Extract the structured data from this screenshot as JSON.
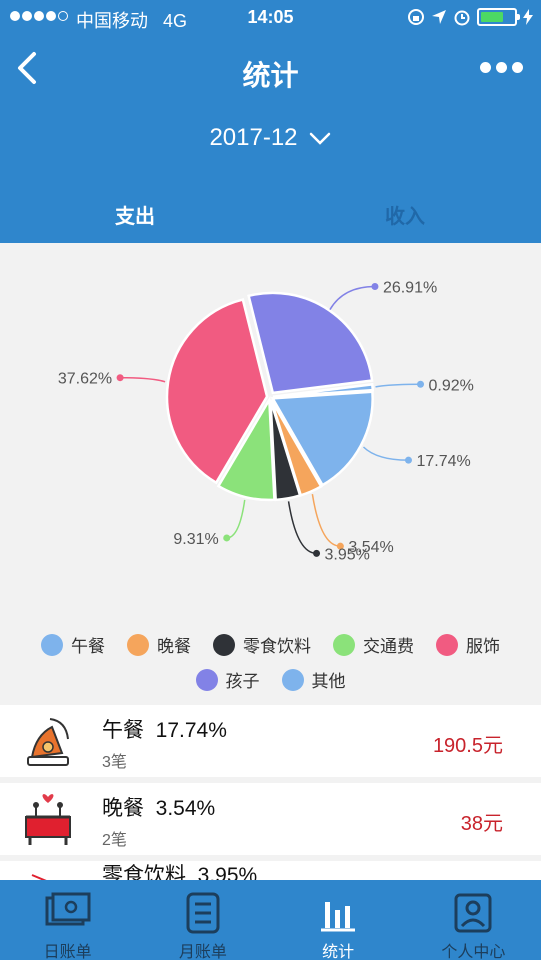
{
  "status_bar": {
    "carrier": "中国移动",
    "network": "4G",
    "time": "14:05"
  },
  "nav": {
    "title": "统计"
  },
  "period": {
    "value": "2017-12"
  },
  "tabs": [
    {
      "label": "支出",
      "active": true
    },
    {
      "label": "收入",
      "active": false
    }
  ],
  "chart_data": {
    "type": "pie",
    "title": "",
    "slices": [
      {
        "label": "孩子",
        "value": 26.91,
        "display": "26.91%",
        "color": "#8282e6"
      },
      {
        "label": "其他",
        "value": 0.92,
        "display": "0.92%",
        "color": "#7eb3ec"
      },
      {
        "label": "午餐",
        "value": 17.74,
        "display": "17.74%",
        "color": "#7eb3ec"
      },
      {
        "label": "晚餐",
        "value": 3.54,
        "display": "3.54%",
        "color": "#f5a55c"
      },
      {
        "label": "零食饮料",
        "value": 3.95,
        "display": "3.95%",
        "color": "#2f3237"
      },
      {
        "label": "交通费",
        "value": 9.31,
        "display": "9.31%",
        "color": "#8be27a"
      },
      {
        "label": "服饰",
        "value": 37.62,
        "display": "37.62%",
        "color": "#f15b81"
      }
    ],
    "legend_placement": "bottom"
  },
  "legend": [
    {
      "label": "午餐",
      "color": "#7eb3ec"
    },
    {
      "label": "晚餐",
      "color": "#f5a55c"
    },
    {
      "label": "零食饮料",
      "color": "#2f3237"
    },
    {
      "label": "交通费",
      "color": "#8be27a"
    },
    {
      "label": "服饰",
      "color": "#f15b81"
    },
    {
      "label": "孩子",
      "color": "#8282e6"
    },
    {
      "label": "其他",
      "color": "#7eb3ec"
    }
  ],
  "records": [
    {
      "name": "午餐",
      "percent": "17.74%",
      "count": "3笔",
      "amount": "190.5元",
      "icon": "lunch-icon"
    },
    {
      "name": "晚餐",
      "percent": "3.54%",
      "count": "2笔",
      "amount": "38元",
      "icon": "dinner-icon"
    },
    {
      "name": "零食饮料",
      "percent": "3.95%",
      "count": "",
      "amount": "",
      "icon": "snack-icon"
    }
  ],
  "tabbar": [
    {
      "label": "日账单",
      "icon": "daily-bill-icon",
      "active": false
    },
    {
      "label": "月账单",
      "icon": "monthly-bill-icon",
      "active": false
    },
    {
      "label": "统计",
      "icon": "statistics-icon",
      "active": true
    },
    {
      "label": "个人中心",
      "icon": "profile-icon",
      "active": false
    }
  ],
  "colors": {
    "header": "#2f86cc",
    "amount": "#c8232c"
  }
}
